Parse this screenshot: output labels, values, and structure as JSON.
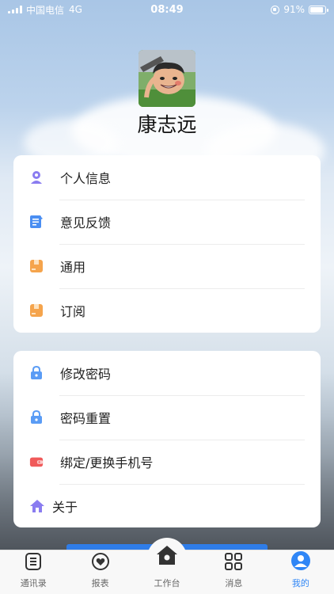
{
  "status_bar": {
    "carrier": "中国电信",
    "network": "4G",
    "time": "08:49",
    "battery": "91%",
    "battery_level": 0.91
  },
  "profile": {
    "name": "康志远"
  },
  "menu_group_1": [
    {
      "label": "个人信息",
      "icon": "person-icon",
      "color": "#8a7cf0"
    },
    {
      "label": "意见反馈",
      "icon": "feedback-icon",
      "color": "#4a8ef2"
    },
    {
      "label": "通用",
      "icon": "box-icon",
      "color": "#f5a44c"
    },
    {
      "label": "订阅",
      "icon": "box-icon",
      "color": "#f5a44c"
    }
  ],
  "menu_group_2": [
    {
      "label": "修改密码",
      "icon": "lock-icon",
      "color": "#5a9cf5"
    },
    {
      "label": "密码重置",
      "icon": "lock-icon",
      "color": "#5a9cf5"
    },
    {
      "label": "绑定/更换手机号",
      "icon": "wallet-icon",
      "color": "#f05a5a"
    },
    {
      "label": "关于",
      "icon": "home-icon",
      "color": "#8a7cf0"
    }
  ],
  "tabbar": [
    {
      "label": "通讯录",
      "icon": "contacts-icon",
      "active": false
    },
    {
      "label": "报表",
      "icon": "heart-icon",
      "active": false
    },
    {
      "label": "工作台",
      "icon": "workbench-home-icon",
      "active": false
    },
    {
      "label": "消息",
      "icon": "grid-icon",
      "active": false
    },
    {
      "label": "我的",
      "icon": "profile-icon",
      "active": true
    }
  ],
  "colors": {
    "accent": "#2f86f6"
  }
}
